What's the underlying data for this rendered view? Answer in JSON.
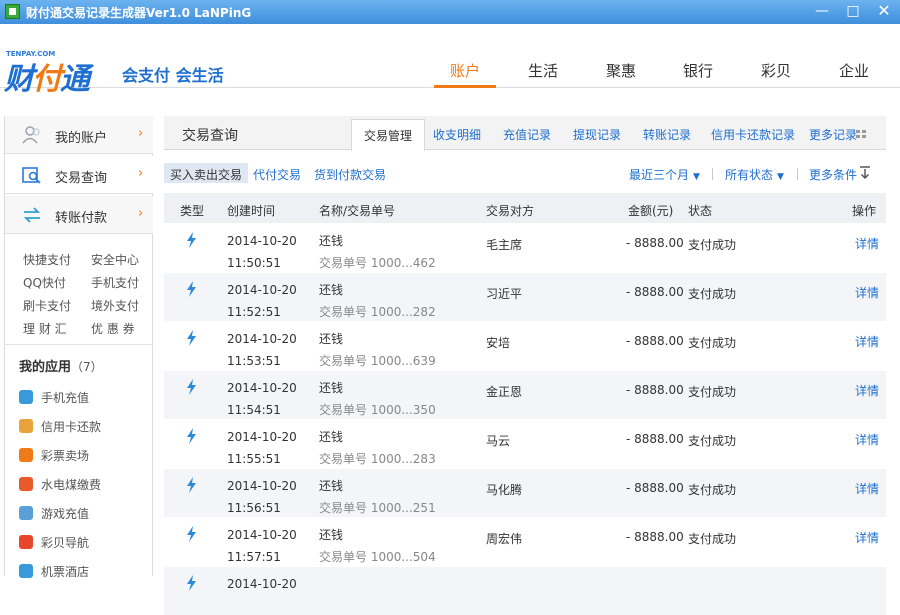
{
  "window": {
    "title": "财付通交易记录生成器Ver1.0  LaNPinG",
    "minimize": "—",
    "maximize": "□",
    "close": "✕"
  },
  "header": {
    "logo_small": "TENPAY.COM",
    "logo_chars": [
      "财",
      "付",
      "通"
    ],
    "slogan": "会支付 会生活",
    "nav": [
      "账户",
      "生活",
      "聚惠",
      "银行",
      "彩贝",
      "企业"
    ],
    "active_nav": 0
  },
  "sidebar": {
    "main_items": [
      {
        "label": "我的账户",
        "icon": "user-icon"
      },
      {
        "label": "交易查询",
        "icon": "search-doc-icon"
      },
      {
        "label": "转账付款",
        "icon": "transfer-icon"
      }
    ],
    "chevron": "›",
    "quick_links": [
      [
        "快捷支付",
        "安全中心"
      ],
      [
        "QQ快付",
        "手机支付"
      ],
      [
        "刷卡支付",
        "境外支付"
      ],
      [
        "理 财 汇",
        "优 惠 券"
      ]
    ],
    "apps_title": "我的应用",
    "apps_count": "（7）",
    "apps": [
      {
        "label": "手机充值",
        "icon": "mobile-recharge-icon",
        "color": "#3a9ad9"
      },
      {
        "label": "信用卡还款",
        "icon": "credit-card-icon",
        "color": "#e8a23a"
      },
      {
        "label": "彩票卖场",
        "icon": "lottery-icon",
        "color": "#f07a16"
      },
      {
        "label": "水电煤缴费",
        "icon": "flame-icon",
        "color": "#e85a2a"
      },
      {
        "label": "游戏充值",
        "icon": "gamepad-icon",
        "color": "#5aa0d8"
      },
      {
        "label": "彩贝导航",
        "icon": "compass-icon",
        "color": "#e8462a"
      },
      {
        "label": "机票酒店",
        "icon": "plane-icon",
        "color": "#3a9ad9"
      }
    ]
  },
  "main": {
    "page_title": "交易查询",
    "tabs": [
      "交易管理",
      "收支明细",
      "充值记录",
      "提现记录",
      "转账记录",
      "信用卡还款记录",
      "更多记录"
    ],
    "active_tab": 0,
    "subtabs": [
      "买入卖出交易",
      "代付交易",
      "货到付款交易"
    ],
    "active_subtab": 0,
    "filters": {
      "range": "最近三个月",
      "status": "所有状态",
      "more": "更多条件"
    },
    "columns": [
      "类型",
      "创建时间",
      "名称/交易单号",
      "交易对方",
      "金额(元)",
      "状态",
      "操作"
    ],
    "rows": [
      {
        "date": "2014-10-20",
        "time": "11:50:51",
        "name": "还钱",
        "order": "交易单号 1000...462",
        "party": "毛主席",
        "amount": "-  8888.00",
        "status": "支付成功",
        "action": "详情"
      },
      {
        "date": "2014-10-20",
        "time": "11:52:51",
        "name": "还钱",
        "order": "交易单号 1000...282",
        "party": "习近平",
        "amount": "-  8888.00",
        "status": "支付成功",
        "action": "详情"
      },
      {
        "date": "2014-10-20",
        "time": "11:53:51",
        "name": "还钱",
        "order": "交易单号 1000...639",
        "party": "安培",
        "amount": "-  8888.00",
        "status": "支付成功",
        "action": "详情"
      },
      {
        "date": "2014-10-20",
        "time": "11:54:51",
        "name": "还钱",
        "order": "交易单号 1000...350",
        "party": "金正恩",
        "amount": "-  8888.00",
        "status": "支付成功",
        "action": "详情"
      },
      {
        "date": "2014-10-20",
        "time": "11:55:51",
        "name": "还钱",
        "order": "交易单号 1000...283",
        "party": "马云",
        "amount": "-  8888.00",
        "status": "支付成功",
        "action": "详情"
      },
      {
        "date": "2014-10-20",
        "time": "11:56:51",
        "name": "还钱",
        "order": "交易单号 1000...251",
        "party": "马化腾",
        "amount": "-  8888.00",
        "status": "支付成功",
        "action": "详情"
      },
      {
        "date": "2014-10-20",
        "time": "11:57:51",
        "name": "还钱",
        "order": "交易单号 1000...504",
        "party": "周宏伟",
        "amount": "-  8888.00",
        "status": "支付成功",
        "action": "详情"
      },
      {
        "date": "2014-10-20",
        "time": "",
        "name": "",
        "order": "",
        "party": "",
        "amount": "",
        "status": "",
        "action": ""
      }
    ],
    "type_icon": "lightning-icon",
    "accent": "#f07a16",
    "link_color": "#1e6fd0"
  }
}
